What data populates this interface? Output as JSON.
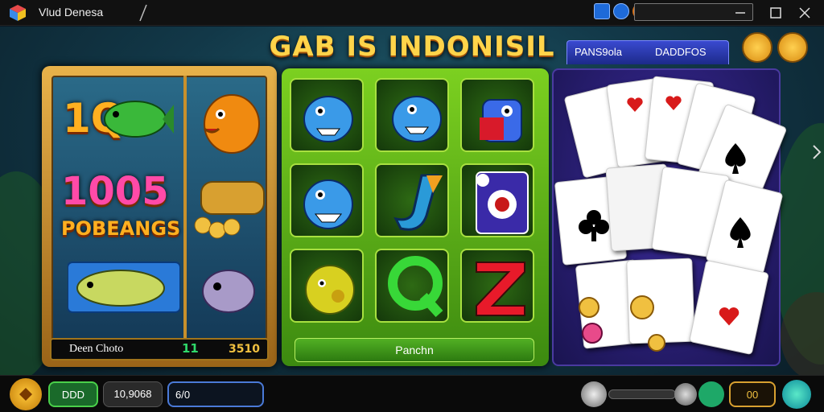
{
  "window": {
    "title": "Vlud Denesa"
  },
  "game": {
    "headline": "GAB IS INDONISIL",
    "slot": {
      "big_text_1": "1Q",
      "big_text_2": "1005",
      "big_text_3": "POBEANGS",
      "footer_label": "Deen Choto",
      "footer_mid": "11",
      "footer_value": "3510"
    },
    "grid": {
      "button_label": "Panchn"
    },
    "cards": {
      "tab_1": "PANS9ola",
      "tab_2": "DADDFOS"
    }
  },
  "bottom": {
    "pill_1": "DDD",
    "pill_2": "10,9068",
    "input_value": "6/0",
    "pill_right": "00"
  },
  "colors": {
    "headline": "#ffd44a",
    "slot_frame": "#e8b24a",
    "grid_green": "#7cd020",
    "card_panel": "#2a1e7a"
  }
}
